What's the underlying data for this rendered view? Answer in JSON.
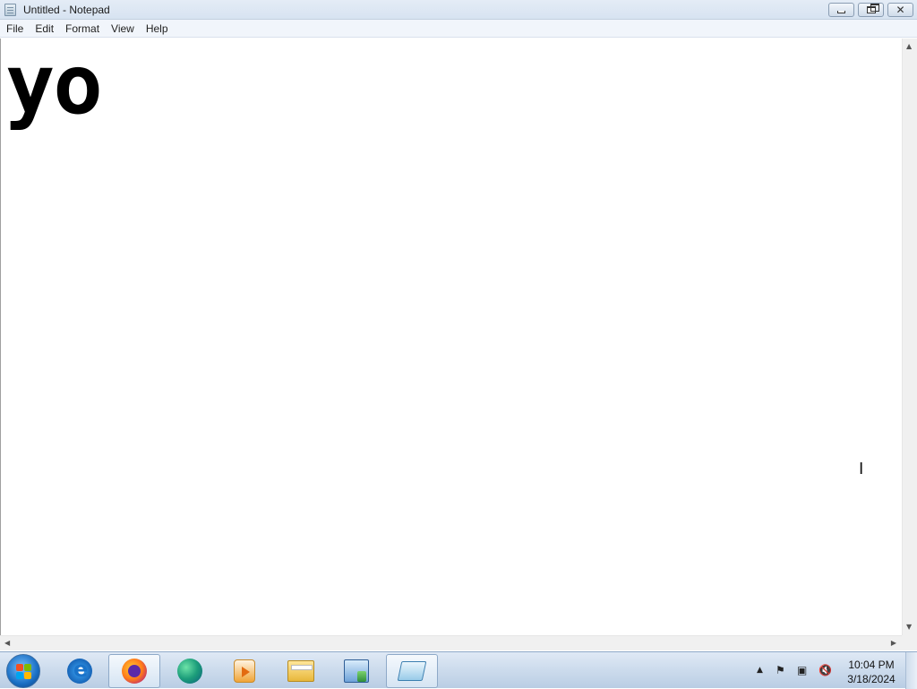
{
  "window": {
    "title": "Untitled - Notepad",
    "icon": "notepad-icon"
  },
  "menu": {
    "items": [
      "File",
      "Edit",
      "Format",
      "View",
      "Help"
    ]
  },
  "editor": {
    "content": "yo"
  },
  "taskbar": {
    "apps": [
      {
        "name": "internet-explorer-icon",
        "active": false
      },
      {
        "name": "firefox-icon",
        "active": true
      },
      {
        "name": "edge-icon",
        "active": false
      },
      {
        "name": "media-player-icon",
        "active": false
      },
      {
        "name": "file-explorer-icon",
        "active": false
      },
      {
        "name": "control-panel-icon",
        "active": false
      },
      {
        "name": "notepad-icon",
        "active": true
      }
    ],
    "clock": {
      "time": "10:04 PM",
      "date": "3/18/2024"
    }
  }
}
